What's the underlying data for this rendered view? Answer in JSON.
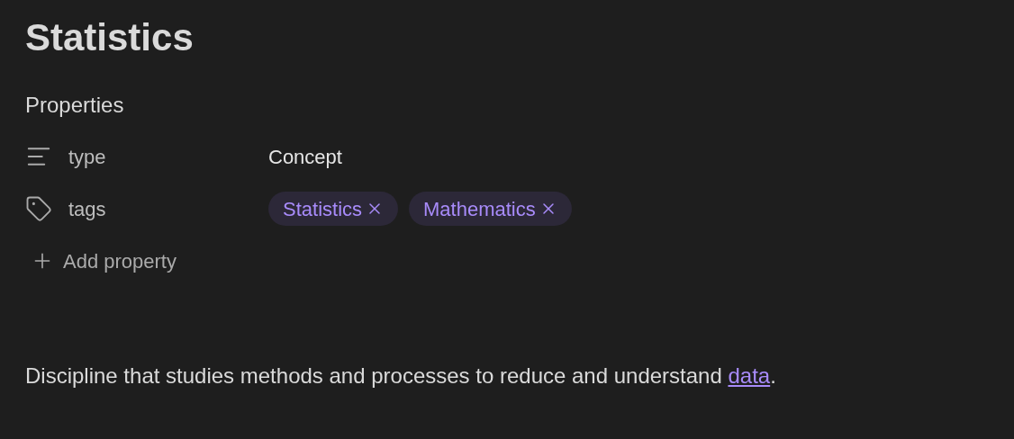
{
  "title": "Statistics",
  "properties": {
    "heading": "Properties",
    "items": [
      {
        "kind": "text",
        "name": "type",
        "value": "Concept"
      },
      {
        "kind": "tags",
        "name": "tags",
        "tags": [
          "Statistics",
          "Mathematics"
        ]
      }
    ],
    "add_label": "Add property"
  },
  "body": {
    "text": "Discipline that studies methods and processes to reduce and understand ",
    "link": "data",
    "after": "."
  }
}
